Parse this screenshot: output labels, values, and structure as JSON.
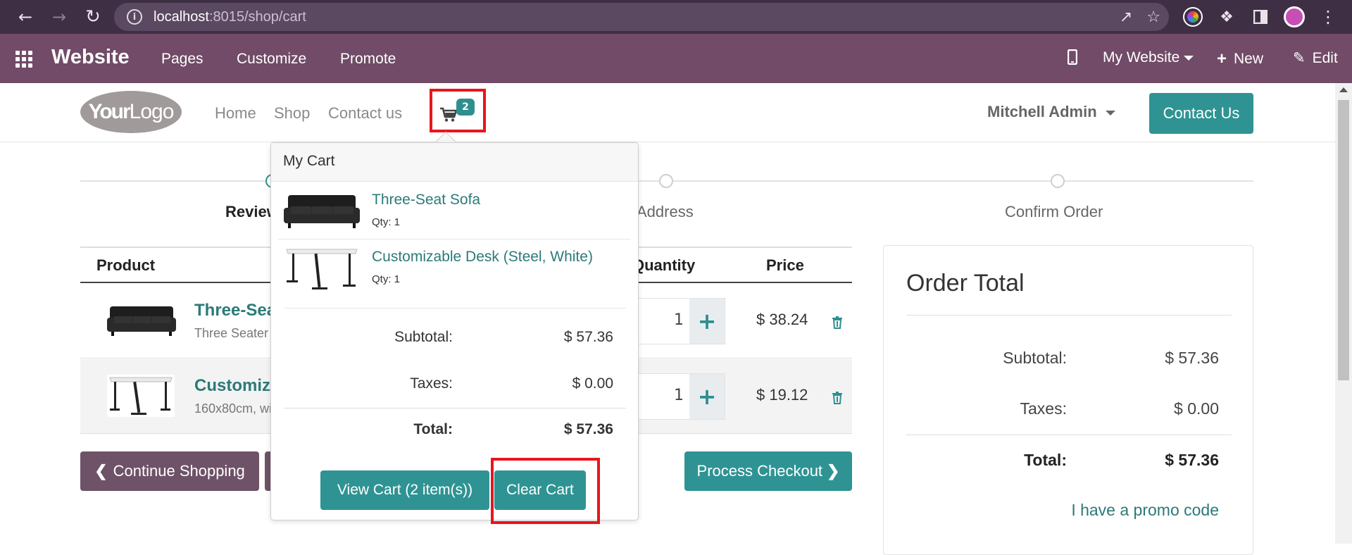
{
  "browser": {
    "url_host": "localhost",
    "url_path": ":8015/shop/cart"
  },
  "odoo_bar": {
    "app_name": "Website",
    "menu": [
      "Pages",
      "Customize",
      "Promote"
    ],
    "site_select": "My Website",
    "new_label": "New",
    "edit_label": "Edit"
  },
  "header": {
    "logo_your": "Your",
    "logo_logo": "Logo",
    "nav": [
      "Home",
      "Shop",
      "Contact us"
    ],
    "cart_count": "2",
    "user": "Mitchell Admin",
    "contact_btn": "Contact Us"
  },
  "steps": {
    "review": "Review Order",
    "address": "Address",
    "confirm": "Confirm Order"
  },
  "table": {
    "col_product": "Product",
    "col_quantity": "Quantity",
    "col_price": "Price",
    "rows": [
      {
        "name": "Three-Seat Sofa",
        "desc": "Three Seater Sofa",
        "qty": "1",
        "price": "$ 38.24"
      },
      {
        "name": "Customizable Desk",
        "desc": "160x80cm, with large legs.",
        "qty": "1",
        "price": "$ 19.12"
      }
    ]
  },
  "buttons": {
    "continue": "Continue Shopping",
    "checkout": "Process Checkout"
  },
  "order_total": {
    "title": "Order Total",
    "subtotal_label": "Subtotal:",
    "subtotal": "$ 57.36",
    "taxes_label": "Taxes:",
    "taxes": "$ 0.00",
    "total_label": "Total:",
    "total": "$ 57.36",
    "promo": "I have a promo code"
  },
  "popover": {
    "title": "My Cart",
    "items": [
      {
        "name": "Three-Seat Sofa",
        "qty": "Qty: 1"
      },
      {
        "name": "Customizable Desk (Steel, White)",
        "qty": "Qty: 1"
      }
    ],
    "subtotal_label": "Subtotal:",
    "subtotal": "$ 57.36",
    "taxes_label": "Taxes:",
    "taxes": "$ 0.00",
    "total_label": "Total:",
    "total": "$ 57.36",
    "view_cart": "View Cart (2 item(s))",
    "clear_cart": "Clear Cart"
  },
  "colors": {
    "odoo_purple": "#714b67",
    "teal": "#2f9393",
    "highlight": "#e8151c"
  }
}
